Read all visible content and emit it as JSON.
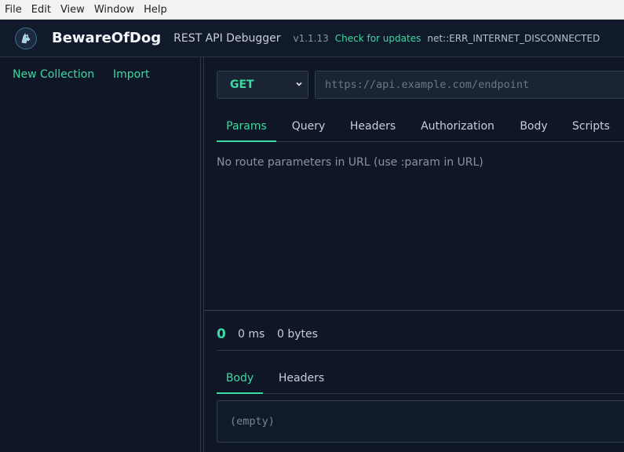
{
  "menu": [
    "File",
    "Edit",
    "View",
    "Window",
    "Help"
  ],
  "header": {
    "app_name": "BewareOfDog",
    "subtitle": "REST API Debugger",
    "version": "v1.1.13",
    "update_link": "Check for updates",
    "network_status": "net::ERR_INTERNET_DISCONNECTED"
  },
  "sidebar": {
    "new_collection": "New Collection",
    "import": "Import"
  },
  "request": {
    "method": "GET",
    "url_placeholder": "https://api.example.com/endpoint",
    "tabs": [
      "Params",
      "Query",
      "Headers",
      "Authorization",
      "Body",
      "Scripts"
    ],
    "active_tab": "Params",
    "params_message": "No route parameters in URL (use :param in URL)"
  },
  "response": {
    "status_code": "0",
    "time": "0 ms",
    "size": "0 bytes",
    "tabs": [
      "Body",
      "Headers"
    ],
    "active_tab": "Body",
    "body": "(empty)"
  },
  "colors": {
    "accent": "#3dd9a3",
    "background": "#0f1626"
  }
}
